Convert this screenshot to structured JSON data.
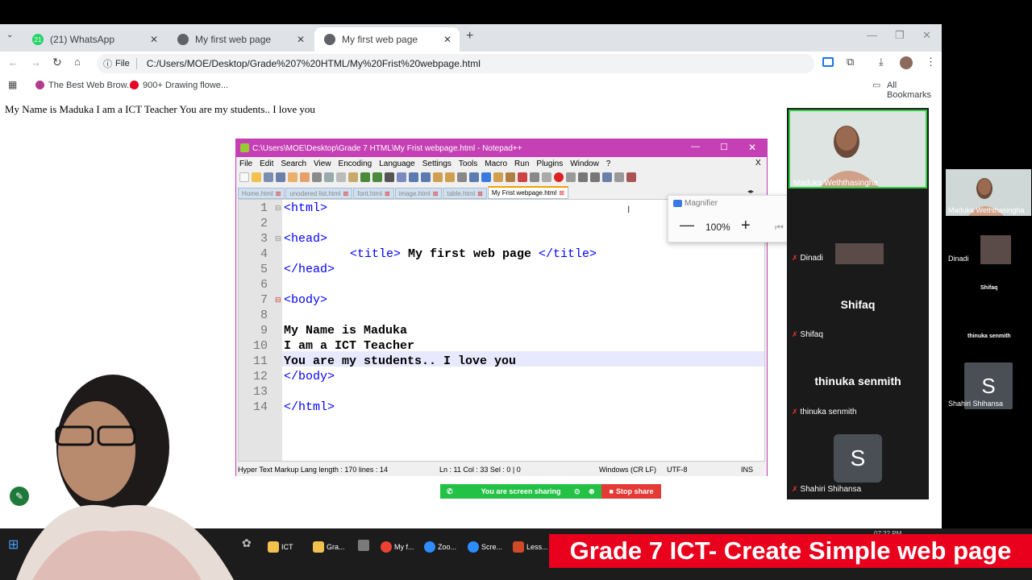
{
  "browser": {
    "tabs": [
      {
        "label": "(21) WhatsApp",
        "badge": "21"
      },
      {
        "label": "My first web page"
      },
      {
        "label": "My first web page"
      }
    ],
    "file_label": "File",
    "url": "C:/Users/MOE/Desktop/Grade%207%20HTML/My%20Frist%20webpage.html",
    "bookmarks": [
      "The Best Web Brow...",
      "900+ Drawing flowe..."
    ],
    "all_bookmarks": "All Bookmarks",
    "page_text": "My Name is Maduka I am a ICT Teacher You are my students.. I love you"
  },
  "notepad": {
    "title": "C:\\Users\\MOE\\Desktop\\Grade 7 HTML\\My Frist webpage.html - Notepad++",
    "menu": [
      "File",
      "Edit",
      "Search",
      "View",
      "Encoding",
      "Language",
      "Settings",
      "Tools",
      "Macro",
      "Run",
      "Plugins",
      "Window",
      "?"
    ],
    "close_x": "X",
    "tabs": [
      "Home.html",
      "unodered list.html",
      "font.html",
      "image.html",
      "table.html",
      "My Frist webpage.html"
    ],
    "line_numbers": [
      "1",
      "2",
      "3",
      "4",
      "5",
      "6",
      "7",
      "8",
      "9",
      "10",
      "11",
      "12",
      "13",
      "14"
    ],
    "code": {
      "l1": "<html>",
      "l3": "<head>",
      "l4_open": "<title>",
      "l4_text": " My first web page ",
      "l4_close": "</title>",
      "l5": "</head>",
      "l7": "<body>",
      "l9": "My Name is Maduka",
      "l10": "I am a ICT Teacher",
      "l11": "You are my students.. I love you",
      "l12": "</body>",
      "l14": "</html>"
    },
    "status": {
      "type": "Hyper Text Markup Lang length : 170    lines : 14",
      "pos": "Ln : 11    Col : 33    Sel : 0 | 0",
      "eol": "Windows (CR LF)",
      "enc": "UTF-8",
      "ins": "INS"
    }
  },
  "magnifier": {
    "title": "Magnifier",
    "zoom": "100%"
  },
  "sharing": {
    "status": "You are screen sharing",
    "stop": "Stop share"
  },
  "participants": {
    "main_speaker": "Maduka Weththasingha",
    "list": [
      {
        "name": "Dinadi"
      },
      {
        "name": "Shifaq",
        "big": "Shifaq"
      },
      {
        "name": "thinuka senmith",
        "big": "thinuka senmith"
      },
      {
        "name": "Shahiri Shihansa",
        "initial": "S"
      }
    ],
    "side": [
      {
        "name": "Maduka Weththasingha"
      },
      {
        "name": "Dinadi"
      },
      {
        "name": "Shifaq"
      },
      {
        "name": "thinuka senmith"
      },
      {
        "name": "Shahiri Shihansa",
        "initial": "S"
      }
    ]
  },
  "taskbar": {
    "items": [
      "ICT",
      "Gra...",
      "My f...",
      "Zoo...",
      "Scre...",
      "Less..."
    ],
    "clock": "07:22 PM"
  },
  "banner": "Grade 7 ICT- Create Simple web page"
}
